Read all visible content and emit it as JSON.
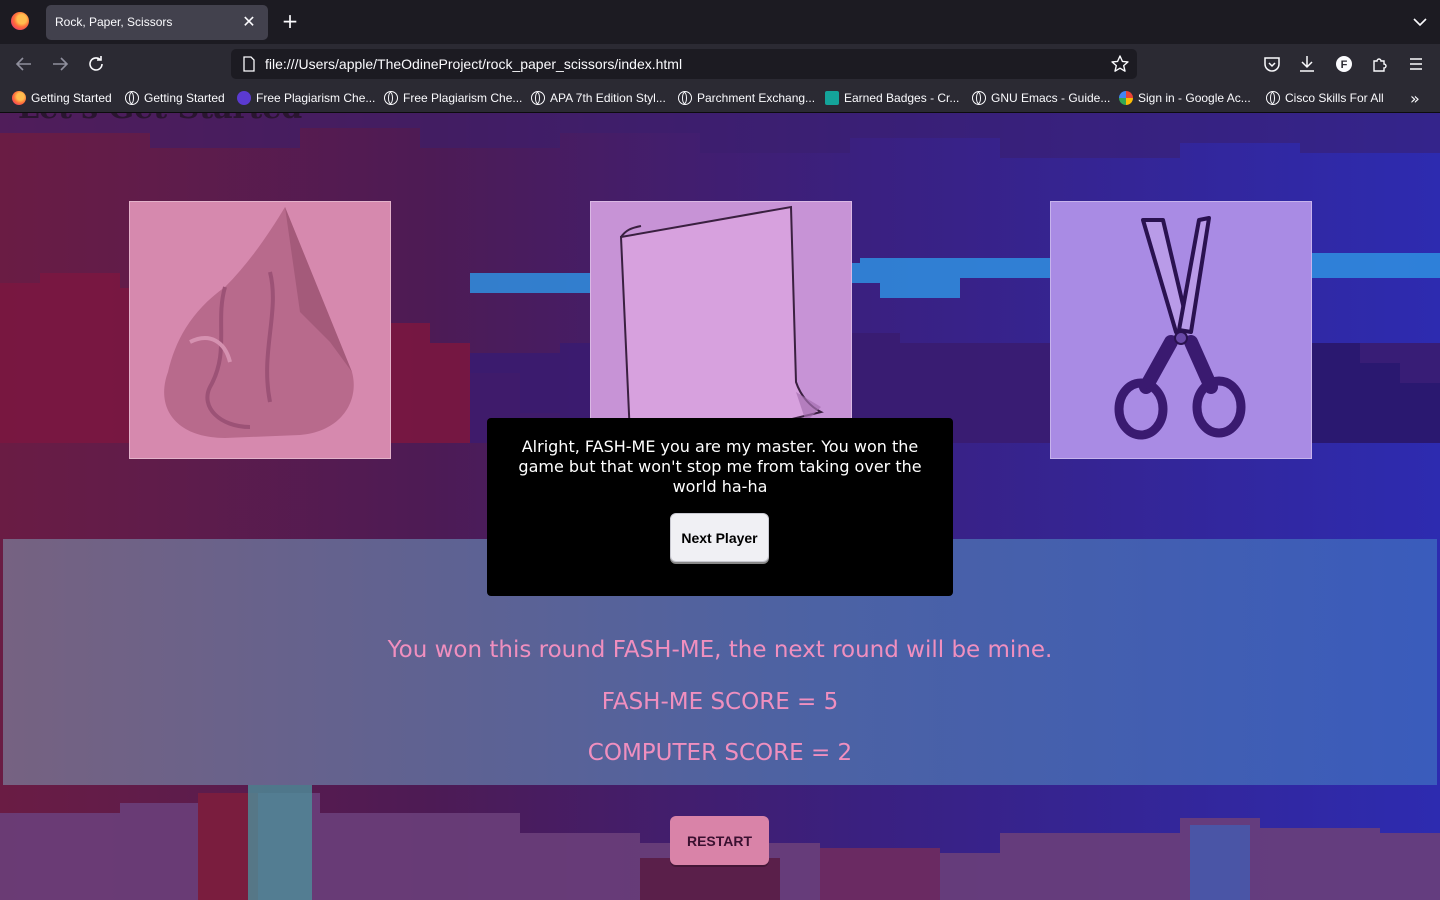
{
  "browser": {
    "tab_title": "Rock, Paper, Scissors",
    "url": "file:///Users/apple/TheOdineProject/rock_paper_scissors/index.html",
    "bookmarks": [
      {
        "label": "Getting Started",
        "icon": "firefox-icon"
      },
      {
        "label": "Getting Started",
        "icon": "globe-icon"
      },
      {
        "label": "Free Plagiarism Che...",
        "icon": "plagiarism-site-icon"
      },
      {
        "label": "Free Plagiarism Che...",
        "icon": "globe-icon"
      },
      {
        "label": "APA 7th Edition Styl...",
        "icon": "globe-icon"
      },
      {
        "label": "Parchment Exchang...",
        "icon": "globe-icon"
      },
      {
        "label": "Earned Badges - Cr...",
        "icon": "credly-icon"
      },
      {
        "label": "GNU Emacs - Guide...",
        "icon": "globe-icon"
      },
      {
        "label": "Sign in - Google Ac...",
        "icon": "google-icon"
      },
      {
        "label": "Cisco Skills For All",
        "icon": "globe-icon"
      }
    ]
  },
  "page": {
    "choices": [
      {
        "name": "rock",
        "icon": "rock-icon"
      },
      {
        "name": "paper",
        "icon": "paper-icon"
      },
      {
        "name": "scissors",
        "icon": "scissors-icon"
      }
    ],
    "round_message": "You won this round FASH-ME, the next round will be mine.",
    "player_score": "FASH-ME SCORE = 5",
    "computer_score": "COMPUTER SCORE = 2",
    "restart_label": "RESTART"
  },
  "modal": {
    "message": "Alright, FASH-ME you are my master. You won the game but that won't stop me from taking over the world ha-ha",
    "button_label": "Next Player"
  },
  "colors": {
    "rock_card": "#d689ae",
    "paper_card": "#c793d6",
    "scissors_card": "#a98be4",
    "result_text": "#f08fbf",
    "restart_button": "#d983a8"
  }
}
